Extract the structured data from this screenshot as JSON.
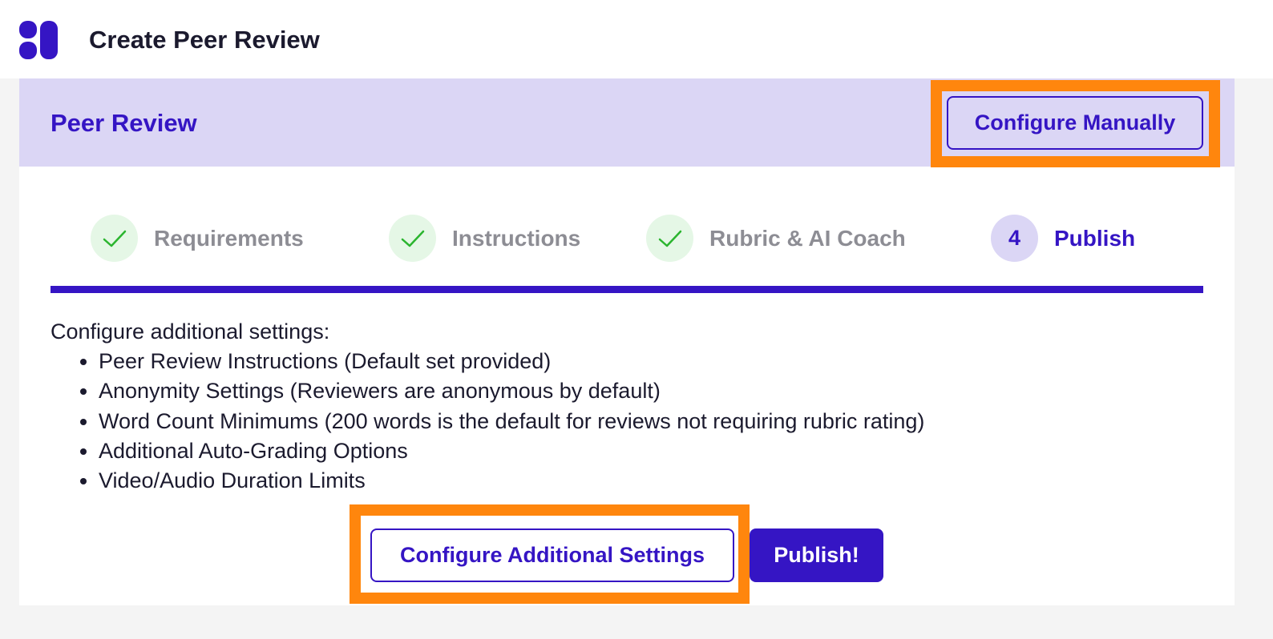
{
  "app": {
    "title": "Create Peer Review",
    "logo": "brand-logo"
  },
  "card": {
    "title": "Peer Review",
    "configure_manually_label": "Configure Manually"
  },
  "steps": [
    {
      "label": "Requirements",
      "status": "complete",
      "icon": "check-icon"
    },
    {
      "label": "Instructions",
      "status": "complete",
      "icon": "check-icon"
    },
    {
      "label": "Rubric & AI Coach",
      "status": "complete",
      "icon": "check-icon"
    },
    {
      "label": "Publish",
      "status": "current",
      "number": "4"
    }
  ],
  "settings": {
    "intro": "Configure additional settings:",
    "items": [
      "Peer Review Instructions (Default set provided)",
      "Anonymity Settings (Reviewers are anonymous by default)",
      "Word Count Minimums (200 words is the default for reviews not requiring rubric rating)",
      "Additional Auto-Grading Options",
      "Video/Audio Duration Limits"
    ]
  },
  "actions": {
    "configure_additional_label": "Configure Additional Settings",
    "publish_label": "Publish!"
  },
  "colors": {
    "brand": "#3515c4",
    "header_bg": "#dbd6f5",
    "highlight": "#ff860d",
    "complete_bg": "#e5f7e6",
    "complete_check": "#2bb52f",
    "muted_text": "#8d8d94"
  }
}
